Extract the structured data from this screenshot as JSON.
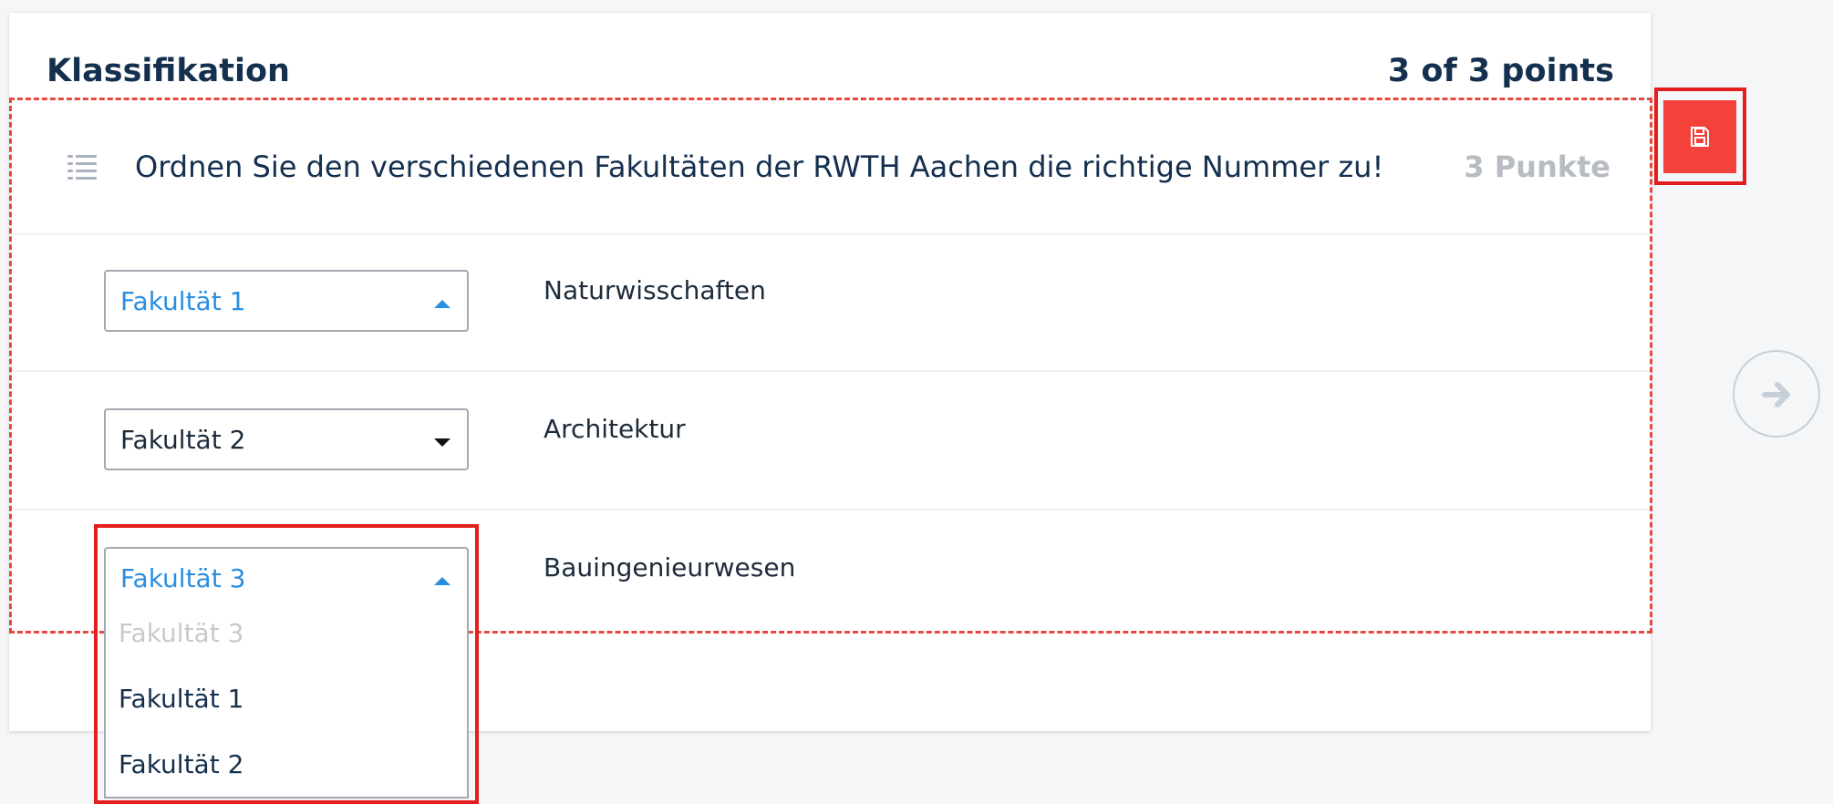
{
  "card": {
    "title": "Klassifikation",
    "points": "3 of 3 points"
  },
  "question": {
    "icon": "list-icon",
    "text": "Ordnen Sie den verschiedenen Fakultäten der RWTH Aachen die richtige Nummer zu!",
    "points": "3 Punkte"
  },
  "rows": [
    {
      "selected": "Fakultät 1",
      "state": "open",
      "label": "Naturwisschaften"
    },
    {
      "selected": "Fakultät 2",
      "state": "closed",
      "label": "Architektur"
    },
    {
      "selected": "Fakultät 3",
      "state": "open",
      "label": "Bauingenieurwesen"
    }
  ],
  "dropdown": {
    "options": [
      {
        "label": "Fakultät 3",
        "disabled": true
      },
      {
        "label": "Fakultät 1",
        "disabled": false
      },
      {
        "label": "Fakultät 2",
        "disabled": false
      }
    ]
  },
  "actions": {
    "save_icon": "floppy-disk-icon",
    "next_icon": "arrow-right-icon"
  },
  "colors": {
    "accent_red": "#f4423b",
    "highlight_red": "#e41d1d",
    "link_blue": "#2a8ee0",
    "title_navy": "#14304e"
  }
}
